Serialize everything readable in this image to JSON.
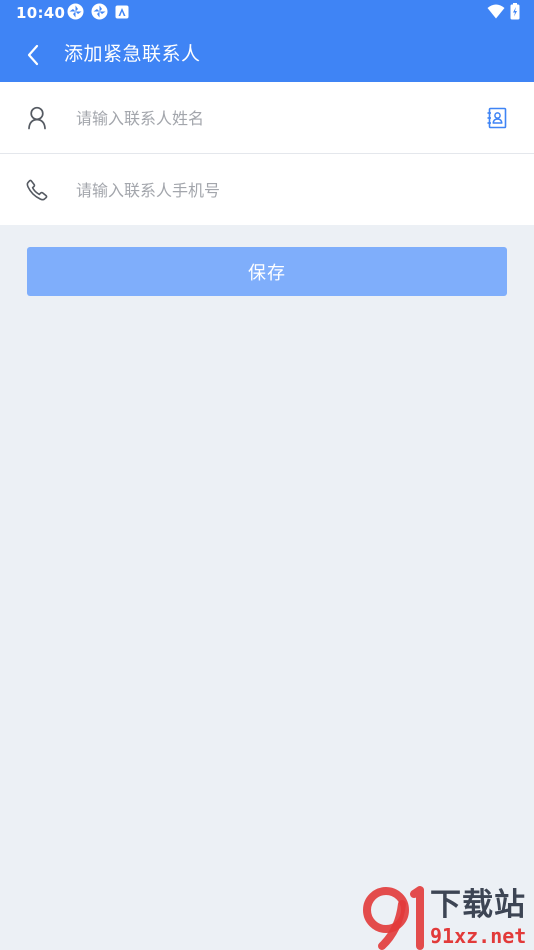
{
  "status_bar": {
    "time": "10:40"
  },
  "app_bar": {
    "title": "添加紧急联系人",
    "back_icon": "chevron-left-icon"
  },
  "form": {
    "name_field": {
      "icon": "person-icon",
      "placeholder": "请输入联系人姓名",
      "value": "",
      "action_icon": "contacts-book-icon"
    },
    "phone_field": {
      "icon": "phone-icon",
      "placeholder": "请输入联系人手机号",
      "value": ""
    }
  },
  "save_button": {
    "label": "保存"
  },
  "watermark": {
    "logo_text": "下载站",
    "domain": "91xz.net"
  },
  "colors": {
    "primary": "#3F84F5",
    "button_disabled": "#7FAEFB",
    "background": "#ECF0F5",
    "placeholder": "#A3A6AC",
    "watermark_red": "#E23A3A"
  }
}
